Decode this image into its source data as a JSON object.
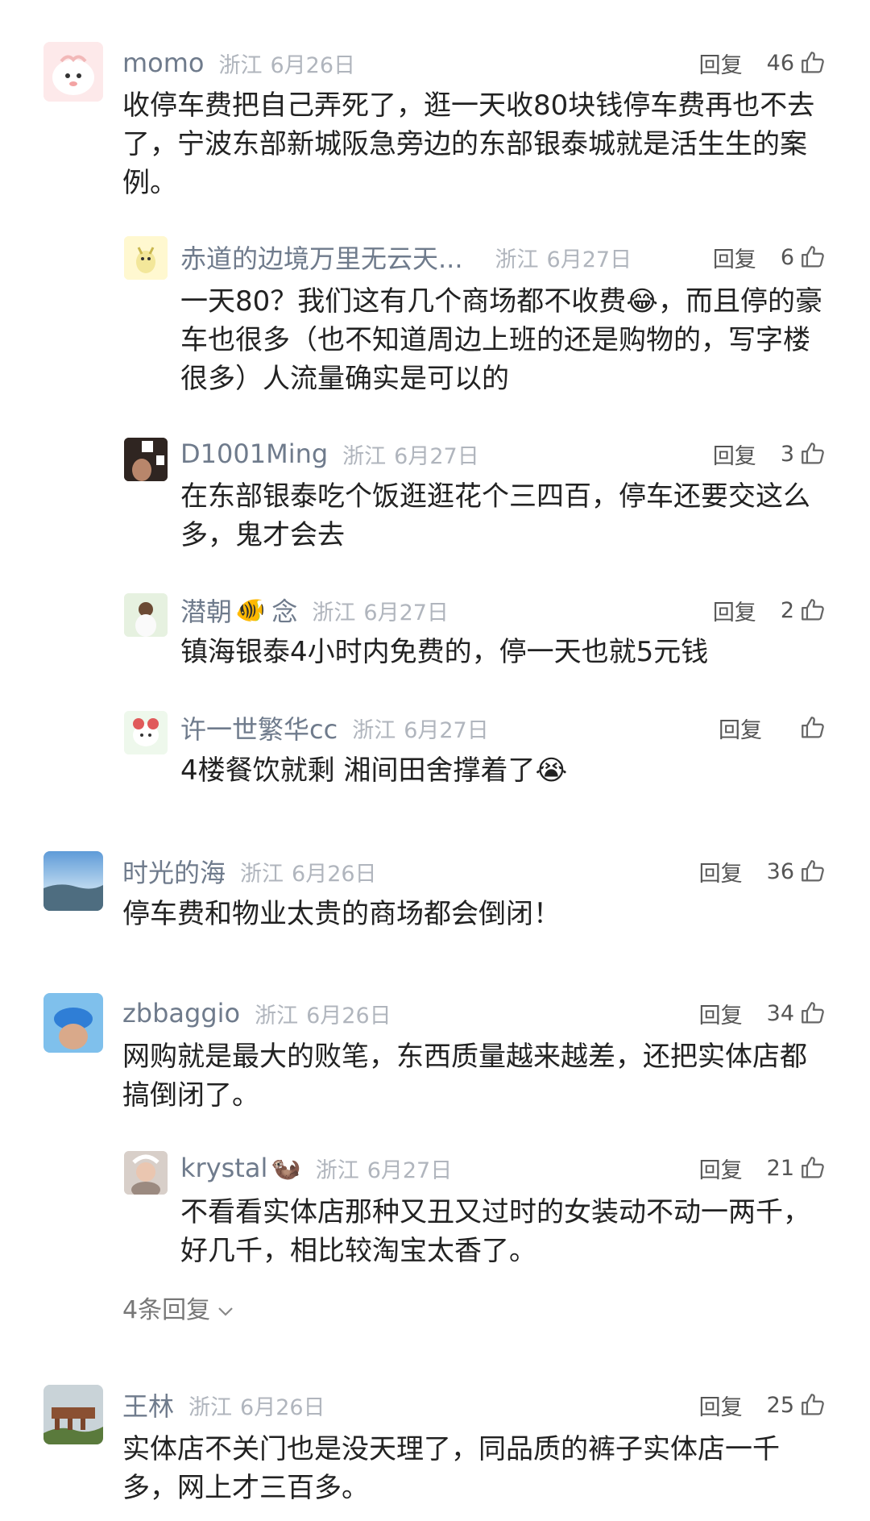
{
  "comments": [
    {
      "name": "momo",
      "location": "浙江",
      "date": "6月26日",
      "reply_label": "回复",
      "likes": "46",
      "text": "收停车费把自己弄死了，逛一天收80块钱停车费再也不去了，宁波东部新城阪急旁边的东部银泰城就是活生生的案例。",
      "avatar": "pink-blob-avatar",
      "replies": [
        {
          "name": "赤道的边境万里无云天...",
          "location": "浙江",
          "date": "6月27日",
          "reply_label": "回复",
          "likes": "6",
          "text": "一天80？我们这有几个商场都不收费😂，而且停的豪车也很多（也不知道周边上班的还是购物的，写字楼很多）人流量确实是可以的"
        },
        {
          "name": "D1001Ming",
          "location": "浙江",
          "date": "6月27日",
          "reply_label": "回复",
          "likes": "3",
          "text": "在东部银泰吃个饭逛逛花个三四百，停车还要交这么多，鬼才会去"
        },
        {
          "name": "潜朝",
          "name_emoji": "🐠",
          "name_suffix": "念",
          "location": "浙江",
          "date": "6月27日",
          "reply_label": "回复",
          "likes": "2",
          "text": "镇海银泰4小时内免费的，停一天也就5元钱"
        },
        {
          "name": "许一世繁华cc",
          "location": "浙江",
          "date": "6月27日",
          "reply_label": "回复",
          "likes": "",
          "text": "4楼餐饮就剩 湘间田舍撑着了😭"
        }
      ]
    },
    {
      "name": "时光的海",
      "location": "浙江",
      "date": "6月26日",
      "reply_label": "回复",
      "likes": "36",
      "text": "停车费和物业太贵的商场都会倒闭！"
    },
    {
      "name": "zbbaggio",
      "location": "浙江",
      "date": "6月26日",
      "reply_label": "回复",
      "likes": "34",
      "text": "网购就是最大的败笔，东西质量越来越差，还把实体店都搞倒闭了。",
      "replies": [
        {
          "name": "krystal",
          "name_emoji": "🦦",
          "location": "浙江",
          "date": "6月27日",
          "reply_label": "回复",
          "likes": "21",
          "text": "不看看实体店那种又丑又过时的女装动不动一两千，好几千，相比较淘宝太香了。"
        }
      ],
      "more_replies": "4条回复"
    },
    {
      "name": "王林",
      "location": "浙江",
      "date": "6月26日",
      "reply_label": "回复",
      "likes": "25",
      "text": "实体店不关门也是没天理了，同品质的裤子实体店一千多，网上才三百多。"
    }
  ]
}
